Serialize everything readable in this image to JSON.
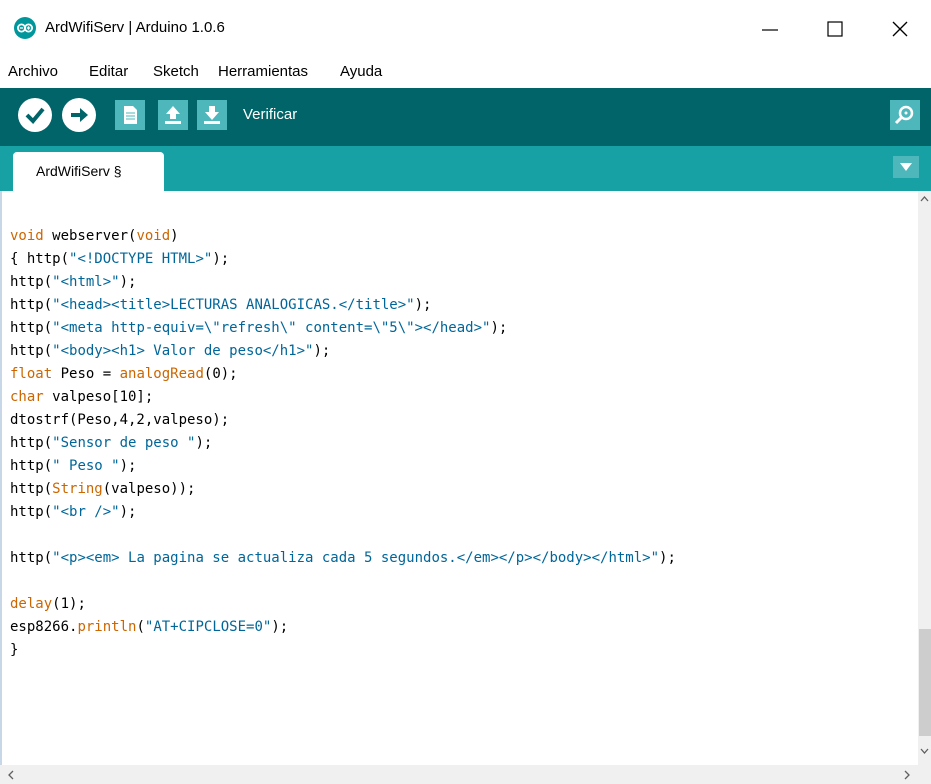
{
  "window": {
    "title": "ArdWifiServ | Arduino 1.0.6",
    "logo_icon": "arduino-logo-icon",
    "controls": [
      "minimize-icon",
      "maximize-icon",
      "close-icon"
    ]
  },
  "menubar": {
    "items": [
      "Archivo",
      "Editar",
      "Sketch",
      "Herramientas",
      "Ayuda"
    ]
  },
  "toolbar": {
    "hint": "Verificar",
    "buttons": [
      "verify-icon",
      "upload-icon",
      "new-file-icon",
      "open-icon",
      "save-icon"
    ],
    "serial_monitor_icon": "magnifier-icon",
    "background": "#006468",
    "button_color": "#4db7bb"
  },
  "tabs": {
    "active": "ArdWifiServ §",
    "bar_color": "#17a1a5",
    "menu_icon": "triangle-down-icon"
  },
  "editor": {
    "keyword_color": "#cc6600",
    "string_color": "#006699",
    "lines": [
      "void webserver(void)",
      "{ http(\"<!DOCTYPE HTML>\");",
      "http(\"<html>\");",
      "http(\"<head><title>LECTURAS ANALOGICAS.</title>\");",
      "http(\"<meta http-equiv=\\\"refresh\\\" content=\\\"5\\\"></head>\");",
      "http(\"<body><h1> Valor de peso</h1>\");",
      "float Peso = analogRead(0);",
      "char valpeso[10];",
      "dtostrf(Peso,4,2,valpeso);",
      "http(\"Sensor de peso \");",
      "http(\" Peso \");",
      "http(String(valpeso));",
      "http(\"<br />\");",
      "",
      "http(\"<p><em> La pagina se actualiza cada 5 segundos.</em></p></body></html>\");",
      "",
      "delay(1);",
      "esp8266.println(\"AT+CIPCLOSE=0\");",
      "}"
    ]
  }
}
